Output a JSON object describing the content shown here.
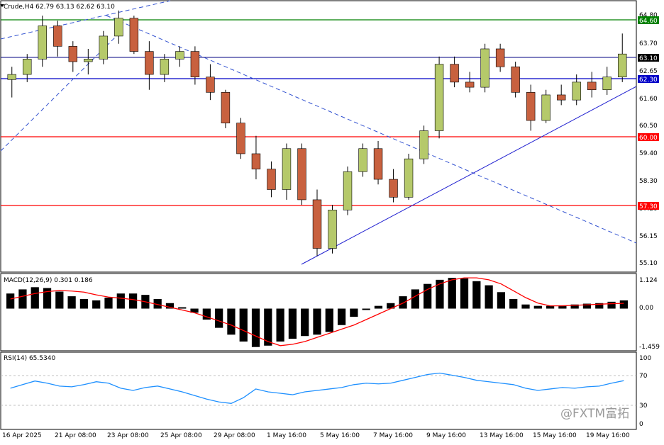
{
  "header": {
    "symbol_line": "Crude,H4  62.79 63.13 62.62 63.10"
  },
  "price_axis": {
    "ticks": [
      "64.80",
      "63.70",
      "62.65",
      "61.60",
      "60.50",
      "59.40",
      "58.30",
      "57.20",
      "56.15",
      "55.10"
    ]
  },
  "hlines": [
    {
      "value": "64.60",
      "color": "#008000"
    },
    {
      "value": "63.10",
      "color": "#000080"
    },
    {
      "value": "62.30",
      "color": "#0000c8"
    },
    {
      "value": "60.00",
      "color": "#ff0000"
    },
    {
      "value": "57.30",
      "color": "#ff0000"
    }
  ],
  "macd": {
    "label": "MACD(12,26,9) 0.301 0.186",
    "ticks": [
      "1.124",
      "0.00",
      "-1.459"
    ]
  },
  "rsi": {
    "label": "RSI(14) 65.5340",
    "ticks": [
      "100",
      "70",
      "30",
      "0"
    ]
  },
  "time_axis": {
    "labels": [
      "16 Apr 2025",
      "21 Apr 08:00",
      "23 Apr 08:00",
      "25 Apr 08:00",
      "29 Apr 08:00",
      "1 May 16:00",
      "5 May 16:00",
      "7 May 16:00",
      "9 May 16:00",
      "13 May 16:00",
      "15 May 16:00",
      "19 May 16:00"
    ]
  },
  "watermark": "@FXTM富拓",
  "chart_data": {
    "type": "candlestick",
    "title": "Crude,H4",
    "ohlc": [
      [
        62.1,
        62.6,
        61.4,
        62.3
      ],
      [
        62.3,
        63.1,
        62.0,
        62.9
      ],
      [
        62.9,
        64.6,
        62.6,
        64.2
      ],
      [
        64.2,
        64.4,
        63.0,
        63.4
      ],
      [
        63.4,
        63.6,
        62.4,
        62.8
      ],
      [
        62.8,
        63.3,
        62.3,
        62.9
      ],
      [
        62.9,
        64.0,
        62.7,
        63.8
      ],
      [
        63.8,
        64.8,
        63.5,
        64.5
      ],
      [
        64.5,
        64.6,
        63.1,
        63.2
      ],
      [
        63.2,
        63.6,
        61.7,
        62.3
      ],
      [
        62.3,
        63.1,
        62.0,
        62.9
      ],
      [
        62.9,
        63.4,
        62.6,
        63.2
      ],
      [
        63.2,
        63.4,
        61.9,
        62.2
      ],
      [
        62.2,
        62.7,
        61.3,
        61.6
      ],
      [
        61.6,
        61.7,
        60.2,
        60.4
      ],
      [
        60.4,
        60.6,
        59.0,
        59.2
      ],
      [
        59.2,
        59.9,
        58.2,
        58.6
      ],
      [
        58.6,
        58.9,
        57.5,
        57.8
      ],
      [
        57.8,
        59.6,
        57.4,
        59.4
      ],
      [
        59.4,
        59.6,
        57.2,
        57.4
      ],
      [
        57.4,
        57.8,
        55.2,
        55.5
      ],
      [
        55.5,
        57.2,
        55.3,
        57.0
      ],
      [
        57.0,
        58.7,
        56.8,
        58.5
      ],
      [
        58.5,
        59.6,
        58.3,
        59.4
      ],
      [
        59.4,
        59.7,
        58.0,
        58.2
      ],
      [
        58.2,
        58.6,
        57.3,
        57.5
      ],
      [
        57.5,
        59.2,
        57.4,
        59.0
      ],
      [
        59.0,
        60.3,
        58.8,
        60.1
      ],
      [
        60.1,
        63.0,
        59.8,
        62.7
      ],
      [
        62.7,
        63.0,
        61.8,
        62.0
      ],
      [
        62.0,
        62.4,
        61.6,
        61.8
      ],
      [
        61.8,
        63.5,
        61.6,
        63.3
      ],
      [
        63.3,
        63.5,
        62.4,
        62.6
      ],
      [
        62.6,
        62.8,
        61.4,
        61.6
      ],
      [
        61.6,
        61.9,
        60.1,
        60.5
      ],
      [
        60.5,
        61.7,
        60.4,
        61.5
      ],
      [
        61.5,
        61.9,
        61.1,
        61.3
      ],
      [
        61.3,
        62.3,
        61.1,
        62.0
      ],
      [
        62.0,
        62.4,
        61.4,
        61.7
      ],
      [
        61.7,
        62.6,
        61.5,
        62.2
      ],
      [
        62.2,
        63.9,
        62.0,
        63.1
      ]
    ],
    "series": [
      {
        "name": "MACD(12,26,9)",
        "values": [
          0.55,
          0.7,
          0.78,
          0.75,
          0.62,
          0.45,
          0.35,
          0.3,
          0.4,
          0.55,
          0.55,
          0.5,
          0.35,
          0.2,
          0.05,
          -0.15,
          -0.4,
          -0.7,
          -0.95,
          -1.2,
          -1.4,
          -1.35,
          -1.2,
          -1.1,
          -1.0,
          -0.95,
          -0.85,
          -0.6,
          -0.3,
          -0.05,
          0.1,
          0.2,
          0.45,
          0.7,
          0.9,
          1.05,
          1.12,
          1.1,
          1.0,
          0.85,
          0.6,
          0.35,
          0.15,
          0.1,
          0.1,
          0.12,
          0.15,
          0.18,
          0.2,
          0.25,
          0.3
        ]
      },
      {
        "name": "Signal",
        "values": [
          0.35,
          0.45,
          0.55,
          0.62,
          0.66,
          0.64,
          0.6,
          0.5,
          0.42,
          0.38,
          0.33,
          0.25,
          0.15,
          0.05,
          -0.05,
          -0.15,
          -0.3,
          -0.45,
          -0.6,
          -0.8,
          -1.0,
          -1.2,
          -1.35,
          -1.3,
          -1.2,
          -1.05,
          -0.9,
          -0.75,
          -0.6,
          -0.4,
          -0.2,
          0.0,
          0.2,
          0.45,
          0.7,
          0.9,
          1.05,
          1.12,
          1.12,
          1.05,
          0.9,
          0.65,
          0.4,
          0.2,
          0.1,
          0.1,
          0.12,
          0.14,
          0.16,
          0.18,
          0.19
        ]
      },
      {
        "name": "RSI(14)",
        "values": [
          55,
          60,
          65,
          62,
          58,
          57,
          60,
          64,
          62,
          55,
          52,
          56,
          58,
          54,
          50,
          45,
          40,
          36,
          34,
          42,
          54,
          50,
          48,
          46,
          50,
          52,
          54,
          56,
          60,
          62,
          61,
          62,
          66,
          70,
          74,
          76,
          73,
          70,
          66,
          64,
          62,
          60,
          55,
          52,
          54,
          56,
          55,
          57,
          58,
          62,
          65.5
        ]
      }
    ],
    "price_range": [
      54.6,
      65.1
    ],
    "macd_range": [
      -1.459,
      1.124
    ],
    "rsi_range": [
      0,
      100
    ]
  }
}
